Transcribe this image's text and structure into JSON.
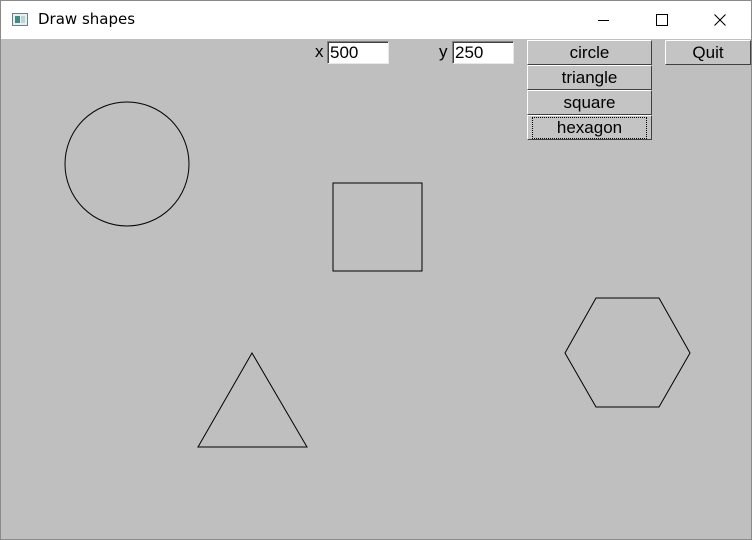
{
  "window": {
    "title": "Draw shapes"
  },
  "icons": {
    "app": "app-window-icon",
    "minimize": "minimize-icon",
    "maximize": "maximize-icon",
    "close": "close-icon"
  },
  "controls": {
    "x_label": "x",
    "x_value": "500",
    "y_label": "y",
    "y_value": "250",
    "buttons": [
      "circle",
      "triangle",
      "square",
      "hexagon"
    ],
    "focused_button": "hexagon",
    "quit_label": "Quit"
  },
  "canvas": {
    "shapes": [
      "circle",
      "square",
      "triangle",
      "hexagon"
    ],
    "stroke_color": "#000000",
    "background_color": "#bfbfbf"
  }
}
